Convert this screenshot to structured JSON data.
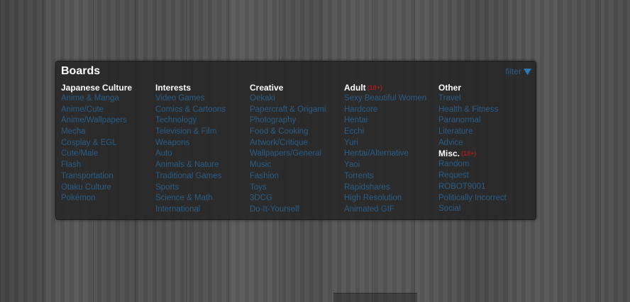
{
  "panel": {
    "title": "Boards",
    "filter_label": "filter",
    "filter_icon": "triangle-down-icon"
  },
  "columns": [
    {
      "heading": "Japanese Culture",
      "items": [
        "Anime & Manga",
        "Anime/Cute",
        "Anime/Wallpapers",
        "Mecha",
        "Cosplay & EGL",
        "Cute/Male",
        "Flash",
        "Transportation",
        "Otaku Culture",
        "Pokémon"
      ]
    },
    {
      "heading": "Interests",
      "items": [
        "Video Games",
        "Comics & Cartoons",
        "Technology",
        "Television & Film",
        "Weapons",
        "Auto",
        "Animals & Nature",
        "Traditional Games",
        "Sports",
        "Science & Math",
        "International"
      ]
    },
    {
      "heading": "Creative",
      "items": [
        "Oekaki",
        "Papercraft & Origami",
        "Photography",
        "Food & Cooking",
        "Artwork/Critique",
        "Wallpapers/General",
        "Music",
        "Fashion",
        "Toys",
        "3DCG",
        "Do-It-Yourself"
      ]
    },
    {
      "heading": "Adult",
      "badge": "(18+)",
      "items": [
        "Sexy Beautiful Women",
        "Hardcore",
        "Hentai",
        "Ecchi",
        "Yuri",
        "Hentai/Alternative",
        "Yaoi",
        "Torrents",
        "Rapidshares",
        "High Resolution",
        "Animated GIF"
      ]
    },
    {
      "heading": "Other",
      "items": [
        "Travel",
        "Health & Fitness",
        "Paranormal",
        "Literature",
        "Advice"
      ],
      "sub_heading": "Misc.",
      "sub_badge": "(18+)",
      "sub_items": [
        "Random",
        "Request",
        "ROBOT9001",
        "Politically Incorrect",
        "Social"
      ]
    }
  ],
  "colors": {
    "link": "#2a5d86",
    "heading": "#ffffff",
    "badge": "#d11a1a",
    "panel_bg": "#262626"
  }
}
